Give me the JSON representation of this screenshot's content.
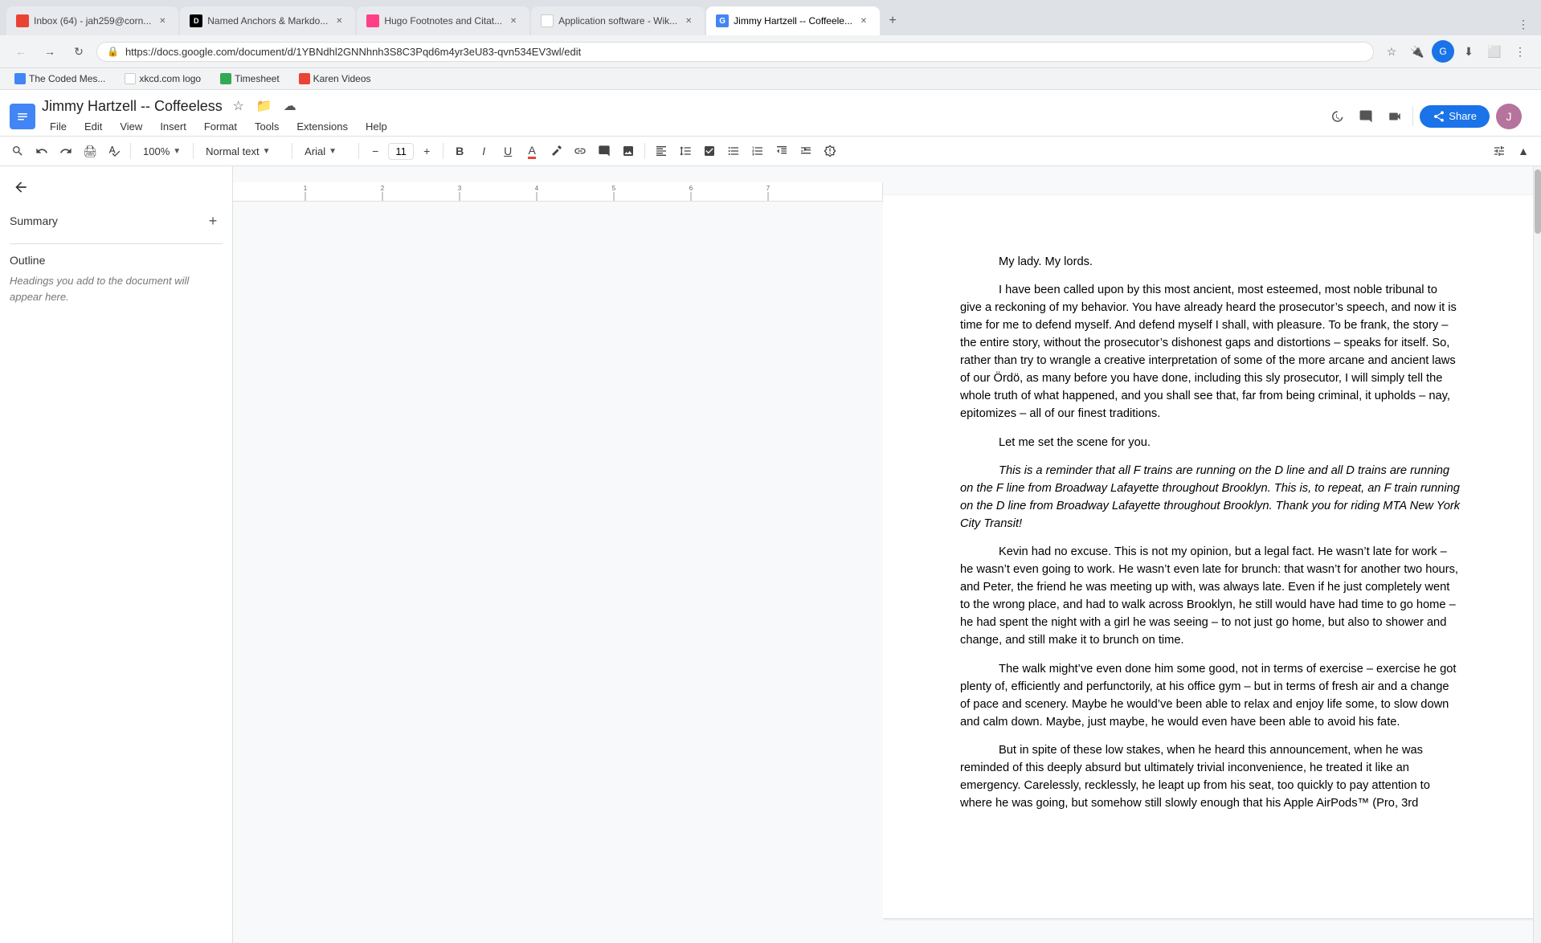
{
  "browser": {
    "tabs": [
      {
        "id": "gmail",
        "title": "Inbox (64) - jah259@corn...",
        "active": false,
        "favicon_type": "gmail"
      },
      {
        "id": "dev",
        "title": "Named Anchors & Markdo...",
        "active": false,
        "favicon_type": "dev"
      },
      {
        "id": "hugo",
        "title": "Hugo Footnotes and Citat...",
        "active": false,
        "favicon_type": "hugo"
      },
      {
        "id": "wiki",
        "title": "Application software - Wik...",
        "active": false,
        "favicon_type": "wiki"
      },
      {
        "id": "gdocs",
        "title": "Jimmy Hartzell -- Coffeele...",
        "active": true,
        "favicon_type": "gdocs"
      }
    ],
    "url": "https://docs.google.com/document/d/1YBNdhl2GNNhnh3S8C3Pqd6m4yr3eU83-qvn534EV3wl/edit",
    "bookmarks": [
      {
        "id": "coded",
        "title": "The Coded Mes...",
        "has_favicon": true
      },
      {
        "id": "xkcd",
        "title": "xkcd.com logo",
        "has_favicon": true
      },
      {
        "id": "timesheet",
        "title": "Timesheet",
        "has_favicon": true
      },
      {
        "id": "karen",
        "title": "Karen Videos",
        "has_favicon": true
      }
    ]
  },
  "docs": {
    "title": "Jimmy Hartzell -- Coffeeless",
    "menu_items": [
      "File",
      "Edit",
      "View",
      "Insert",
      "Format",
      "Tools",
      "Extensions",
      "Help"
    ],
    "toolbar": {
      "zoom": "100%",
      "style": "Normal text",
      "font": "Arial",
      "font_size": "11",
      "style_dropdown_label": "Normal text"
    },
    "sidebar": {
      "back_label": "",
      "summary_title": "Summary",
      "summary_add_label": "+",
      "outline_title": "Outline",
      "outline_hint": "Headings you add to the document will appear here."
    },
    "document": {
      "paragraphs": [
        {
          "id": "p1",
          "text": "My lady. My lords.",
          "indent": true,
          "italic": false
        },
        {
          "id": "p2",
          "text": "I have been called upon by this most ancient, most esteemed, most noble tribunal to give a reckoning of my behavior. You have already heard the prosecutor’s speech, and now it is time for me to defend myself. And defend myself I shall, with pleasure. To be frank, the story – the entire story, without the prosecutor’s dishonest gaps and distortions – speaks for itself. So, rather than try to wrangle a creative interpretation of some of the more arcane and ancient laws of our Ördö, as many before you have done, including this sly prosecutor, I will simply tell the whole truth of what happened, and you shall see that, far from being criminal, it upholds – nay, epitomizes – all of our finest traditions.",
          "indent": true,
          "italic": false
        },
        {
          "id": "p3",
          "text": "Let me set the scene for you.",
          "indent": true,
          "italic": false
        },
        {
          "id": "p4",
          "text": "This is a reminder that all F trains are running on the D line and all D trains are running on the F line from Broadway Lafayette throughout Brooklyn. This is, to repeat, an F train running on the D line from Broadway Lafayette throughout Brooklyn. Thank you for riding MTA New York City Transit!",
          "indent": true,
          "italic": true
        },
        {
          "id": "p5",
          "text": "Kevin had no excuse. This is not my opinion, but a legal fact. He wasn’t late for work – he wasn’t even going to work. He wasn’t even late for brunch: that wasn’t for another two hours, and Peter, the friend he was meeting up with, was always late. Even if he just completely went to the wrong place, and had to walk across Brooklyn, he still would have had time to go home – he had spent the night with a girl he was seeing – to not just go home, but also to shower and change, and still make it to brunch on time.",
          "indent": true,
          "italic": false
        },
        {
          "id": "p6",
          "text": "The walk might’ve even done him some good, not in terms of exercise – exercise he got plenty of, efficiently and perfunctorily, at his office gym – but in terms of fresh air and a change of pace and scenery. Maybe he would’ve been able to relax and enjoy life some, to slow down and calm down. Maybe, just maybe, he would even have been able to avoid his fate.",
          "indent": true,
          "italic": false
        },
        {
          "id": "p7",
          "text": "But in spite of these low stakes, when he heard this announcement, when he was reminded of this deeply absurd but ultimately trivial inconvenience, he treated it like an emergency. Carelessly, recklessly, he leapt up from his seat, too quickly to pay attention to where he was going, but somehow still slowly enough that his Apple AirPods™ (Pro, 3rd",
          "indent": true,
          "italic": false
        }
      ]
    }
  }
}
